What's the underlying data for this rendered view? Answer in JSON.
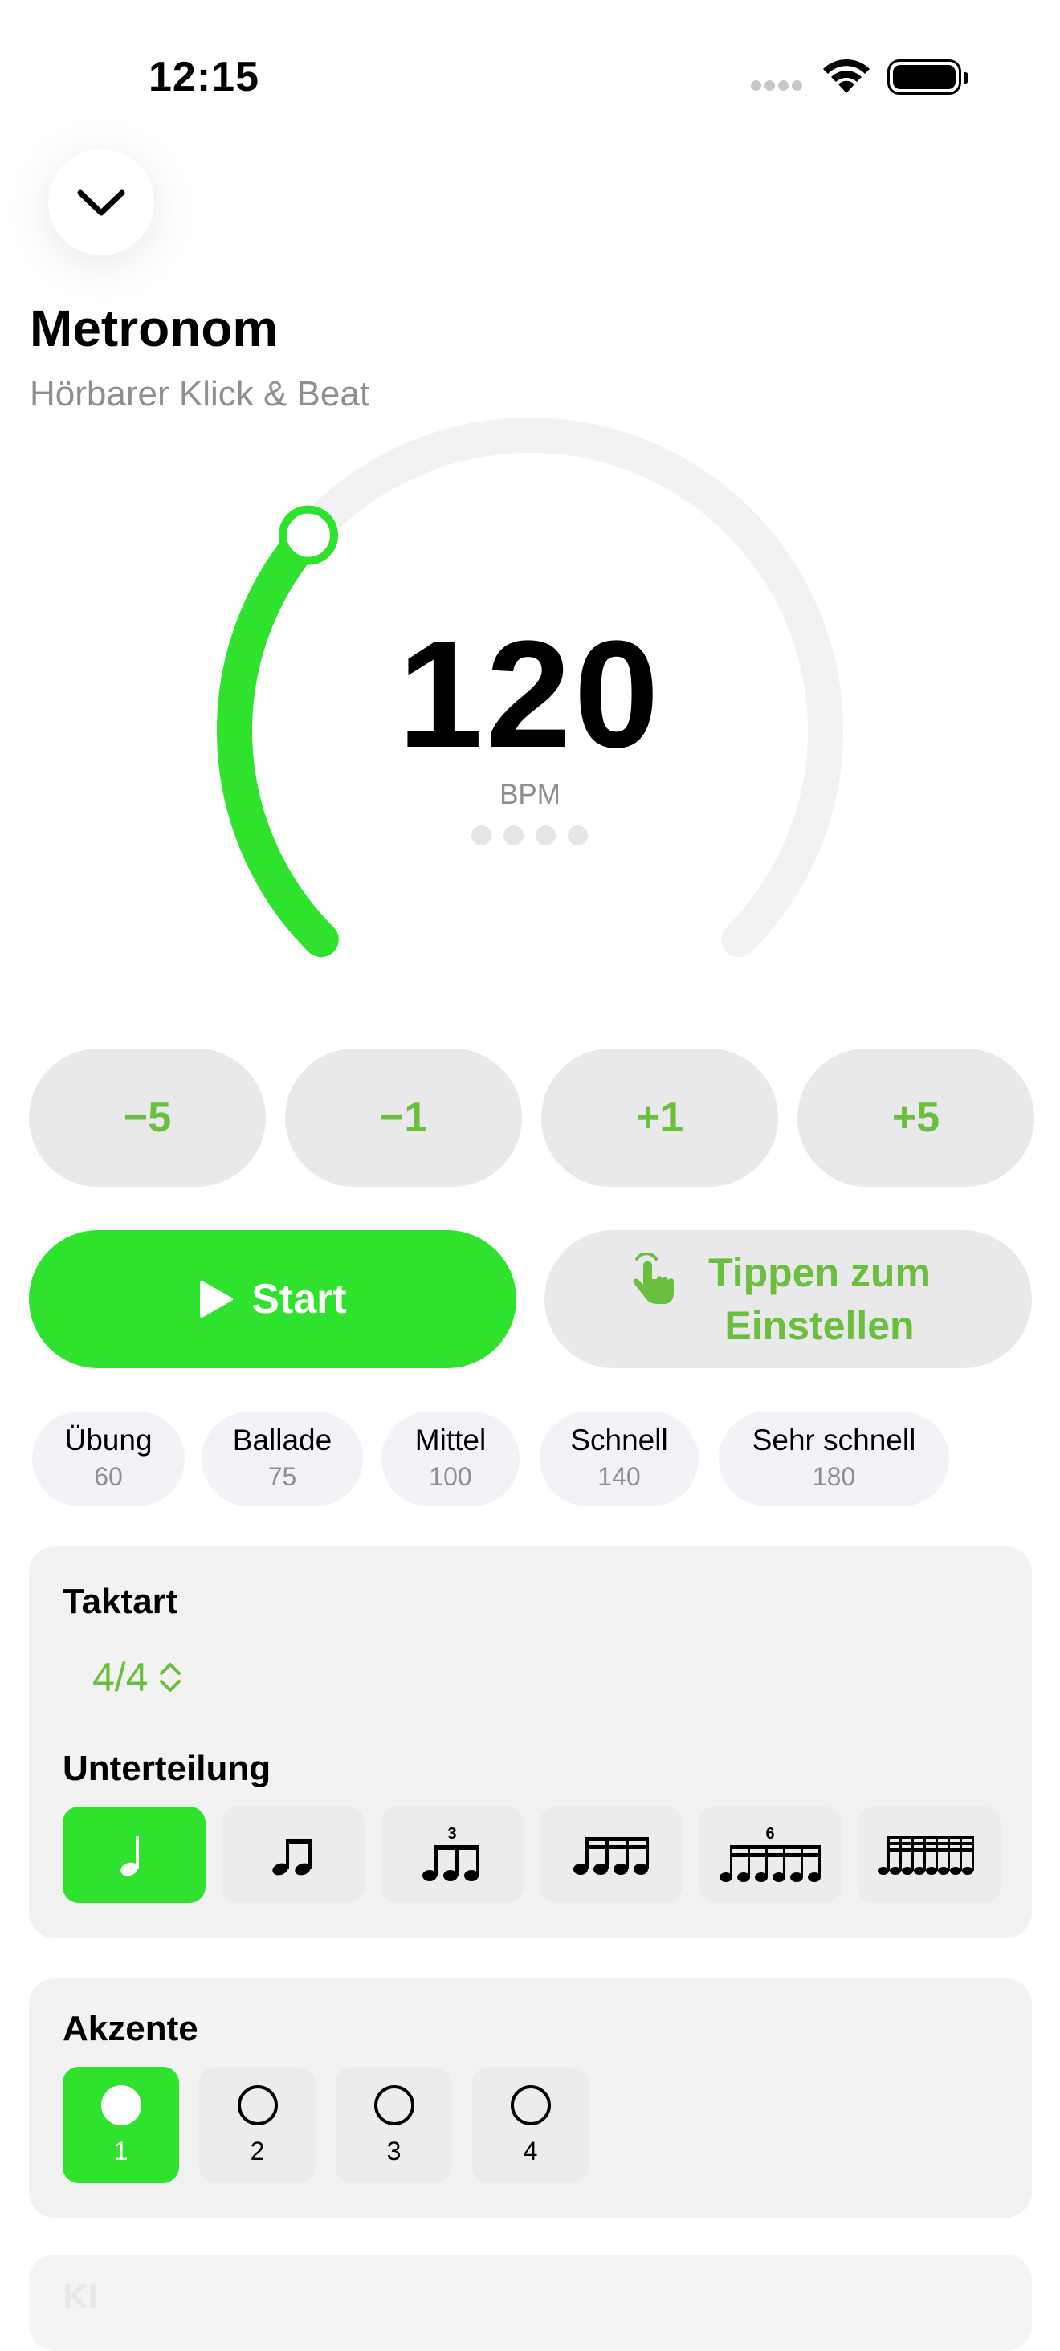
{
  "status_bar": {
    "time": "12:15"
  },
  "header": {
    "title": "Metronom",
    "subtitle": "Hörbarer Klick & Beat"
  },
  "dial": {
    "bpm": "120",
    "unit": "BPM",
    "beat_count": 4,
    "fraction": 0.32,
    "accent_color": "#2ee22e",
    "track_color": "#f2f2f5"
  },
  "steps": [
    {
      "label": "−5"
    },
    {
      "label": "−1"
    },
    {
      "label": "+1"
    },
    {
      "label": "+5"
    }
  ],
  "actions": {
    "start_label": "Start",
    "tap_label": "Tippen zum Einstellen"
  },
  "presets": [
    {
      "name": "Übung",
      "bpm": "60"
    },
    {
      "name": "Ballade",
      "bpm": "75"
    },
    {
      "name": "Mittel",
      "bpm": "100"
    },
    {
      "name": "Schnell",
      "bpm": "140"
    },
    {
      "name": "Sehr schnell",
      "bpm": "180"
    }
  ],
  "settings": {
    "meter_title": "Taktart",
    "meter_value": "4/4",
    "subdivision_title": "Unterteilung",
    "subdivisions": [
      {
        "icon": "quarter-note-icon",
        "active": true
      },
      {
        "icon": "eighth-notes-icon",
        "active": false
      },
      {
        "icon": "triplet-notes-icon",
        "tuplet": "3",
        "active": false
      },
      {
        "icon": "sixteenth-notes-icon",
        "active": false
      },
      {
        "icon": "sextuplet-notes-icon",
        "tuplet": "6",
        "active": false
      },
      {
        "icon": "thirty-second-notes-icon",
        "active": false
      }
    ]
  },
  "accents": {
    "title": "Akzente",
    "beats": [
      {
        "label": "1",
        "active": true
      },
      {
        "label": "2",
        "active": false
      },
      {
        "label": "3",
        "active": false
      },
      {
        "label": "4",
        "active": false
      }
    ]
  },
  "next_section": {
    "title": "Kl"
  }
}
